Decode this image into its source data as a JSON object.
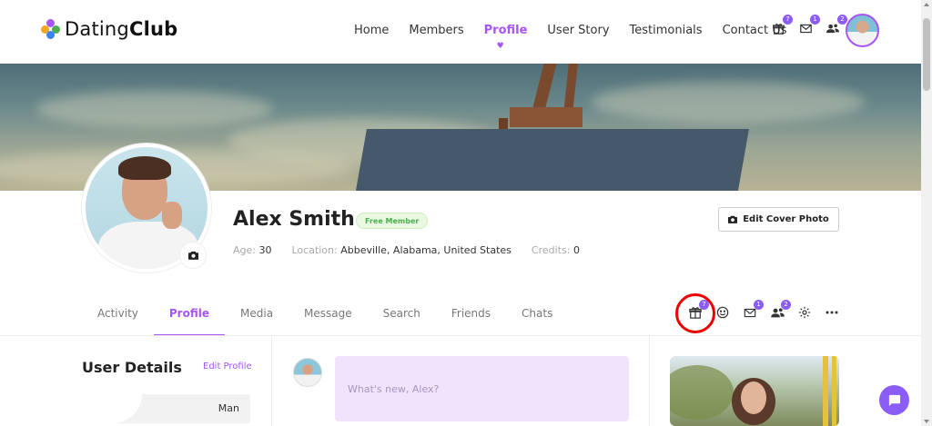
{
  "brand": {
    "name_light": "Dating",
    "name_bold": "Club"
  },
  "nav": {
    "items": [
      {
        "label": "Home"
      },
      {
        "label": "Members"
      },
      {
        "label": "Profile"
      },
      {
        "label": "User Story"
      },
      {
        "label": "Testimonials"
      },
      {
        "label": "Contact Us"
      }
    ],
    "active": "Profile"
  },
  "header_icons": {
    "gift_count": "7",
    "messages_count": "1",
    "friends_count": "2"
  },
  "profile": {
    "name": "Alex Smith",
    "membership": "Free Member",
    "age_label": "Age:",
    "age": "30",
    "location_label": "Location:",
    "location": "Abbeville, Alabama, United States",
    "credits_label": "Credits:",
    "credits": "0",
    "edit_cover_label": "Edit Cover Photo"
  },
  "tabs": {
    "items": [
      {
        "label": "Activity"
      },
      {
        "label": "Profile"
      },
      {
        "label": "Media"
      },
      {
        "label": "Message"
      },
      {
        "label": "Search"
      },
      {
        "label": "Friends"
      },
      {
        "label": "Chats"
      }
    ],
    "active": "Profile"
  },
  "tab_icons": {
    "gift_count": "7",
    "messages_count": "1",
    "friends_count": "2"
  },
  "user_details": {
    "title": "User Details",
    "edit_label": "Edit Profile",
    "gender_value": "Man"
  },
  "composer": {
    "placeholder": "What's new, Alex?"
  },
  "colors": {
    "accent": "#a855f7",
    "badge": "#8b5cf6",
    "member_badge_text": "#4caf50",
    "highlight_ring": "#ee0000"
  }
}
